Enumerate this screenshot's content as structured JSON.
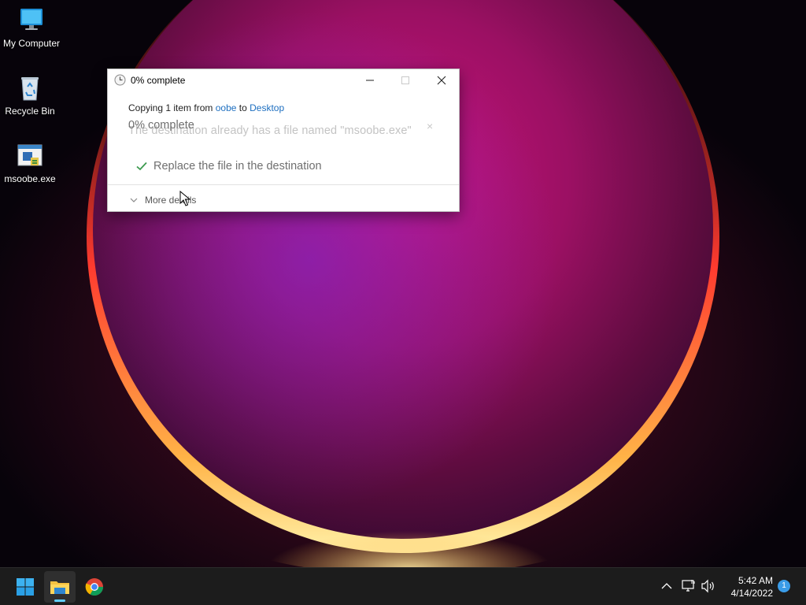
{
  "desktop": {
    "icons": [
      {
        "label": "My Computer",
        "icon": "monitor-icon"
      },
      {
        "label": "Recycle Bin",
        "icon": "recycle-bin-icon"
      },
      {
        "label": "msoobe.exe",
        "icon": "exe-file-icon"
      }
    ]
  },
  "dialog": {
    "title": "0% complete",
    "title_icon": "clock-icon",
    "copy_prefix": "Copying 1 item from ",
    "source": "oobe",
    "copy_mid": " to ",
    "destination": "Desktop",
    "percent": "0% complete",
    "progress_fraction": 0,
    "conflict_text": "The destination already has a file named \"msoobe.exe\"",
    "conflict_close": "×",
    "replace_option": "Replace the file in the destination",
    "more_details": "More details"
  },
  "taskbar": {
    "apps": [
      {
        "name": "Start",
        "icon": "windows-start-icon"
      },
      {
        "name": "File Explorer",
        "icon": "folder-icon",
        "active": true
      },
      {
        "name": "Google Chrome",
        "icon": "chrome-icon"
      }
    ],
    "time": "5:42 AM",
    "date": "4/14/2022",
    "notification_count": "1"
  },
  "colors": {
    "accent": "#60cdff",
    "link": "#1e6fc0",
    "taskbar": "#1c1c1c"
  }
}
